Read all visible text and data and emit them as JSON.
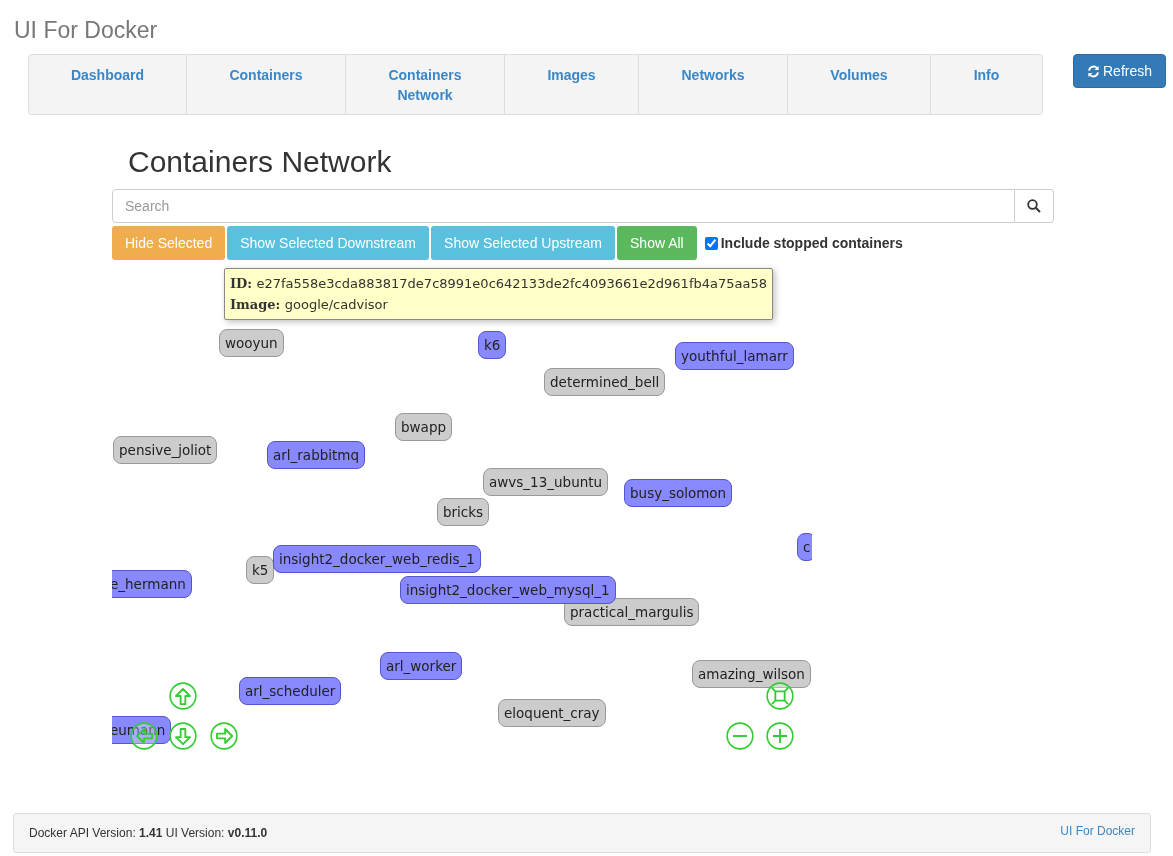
{
  "app_title": "UI For Docker",
  "nav": [
    {
      "label": "Dashboard",
      "selected": false
    },
    {
      "label": "Containers",
      "selected": false
    },
    {
      "label": "Containers Network",
      "selected": false
    },
    {
      "label": "Images",
      "selected": false
    },
    {
      "label": "Networks",
      "selected": false
    },
    {
      "label": "Volumes",
      "selected": false
    },
    {
      "label": "Info",
      "selected": false
    }
  ],
  "refresh_button": "Refresh",
  "heading": "Containers Network",
  "search": {
    "placeholder": "Search"
  },
  "actions": [
    {
      "label": "Hide Selected",
      "kind": "warning"
    },
    {
      "label": "Show Selected Downstream",
      "kind": "info"
    },
    {
      "label": "Show Selected Upstream",
      "kind": "info"
    },
    {
      "label": "Show All",
      "kind": "success"
    }
  ],
  "include_stopped": {
    "label": "Include stopped containers",
    "checked": true
  },
  "nodes": [
    {
      "name": "wooyun",
      "running": false
    },
    {
      "name": "k6",
      "running": true
    },
    {
      "name": "youthful_lamarr",
      "running": true
    },
    {
      "name": "determined_bell",
      "running": false
    },
    {
      "name": "bwapp",
      "running": false
    },
    {
      "name": "pensive_joliot",
      "running": false
    },
    {
      "name": "arl_rabbitmq",
      "running": true
    },
    {
      "name": "awvs_13_ubuntu",
      "running": false
    },
    {
      "name": "busy_solomon",
      "running": true
    },
    {
      "name": "bricks",
      "running": false
    },
    {
      "name": "c",
      "running": true
    },
    {
      "name": "k5",
      "running": false
    },
    {
      "name": "insight2_docker_web_redis_1",
      "running": true
    },
    {
      "name": "e_hermann",
      "running": true
    },
    {
      "name": "practical_margulis",
      "running": false
    },
    {
      "name": "insight2_docker_web_mysql_1",
      "running": true
    },
    {
      "name": "arl_worker",
      "running": true
    },
    {
      "name": "amazing_wilson",
      "running": false
    },
    {
      "name": "arl_scheduler",
      "running": true
    },
    {
      "name": "eloquent_cray",
      "running": false
    },
    {
      "name": "eumann",
      "running": true
    }
  ],
  "tooltip": [
    {
      "label": "ID:",
      "value": "e27fa558e3cda883817de7c8991e0c642133de2fc4093661e2d961fb4a75aa58"
    },
    {
      "label": "Image:",
      "value": "google/cadvisor"
    }
  ],
  "footer": {
    "versions": "Docker API Version: **1.41** UI Version: **v0.11.0**",
    "link": "UI For Docker"
  }
}
